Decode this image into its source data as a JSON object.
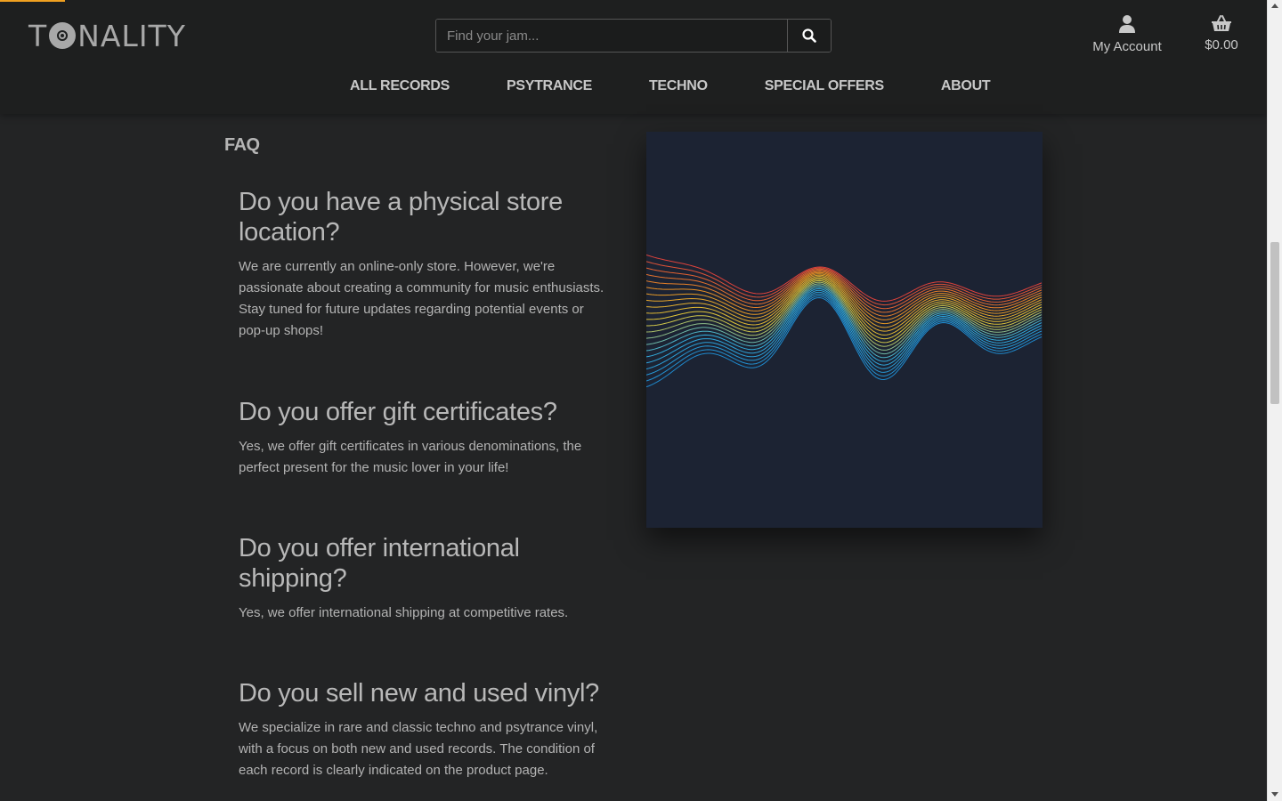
{
  "header": {
    "logo_text_left": "T",
    "logo_text_right": "NALITY",
    "search": {
      "placeholder": "Find your jam..."
    },
    "account_label": "My Account",
    "cart_total": "$0.00",
    "nav": [
      "ALL RECORDS",
      "PSYTRANCE",
      "TECHNO",
      "SPECIAL OFFERS",
      "ABOUT"
    ]
  },
  "main": {
    "heading": "FAQ",
    "faqs": [
      {
        "question": "Do you have a physical store location?",
        "answer": "We are currently an online-only store. However, we're passionate about creating a community for music enthusiasts. Stay tuned for future updates regarding potential events or pop-up shops!"
      },
      {
        "question": "Do you offer gift certificates?",
        "answer": "Yes, we offer gift certificates in various denominations, the perfect present for the music lover in your life!"
      },
      {
        "question": "Do you offer international shipping?",
        "answer": "Yes, we offer international shipping at competitive rates."
      },
      {
        "question": "Do you sell new and used vinyl?",
        "answer": "We specialize in rare and classic techno and psytrance vinyl, with a focus on both new and used records. The condition of each record is clearly indicated on the product page."
      }
    ]
  },
  "colors": {
    "background": "#232425",
    "header_bg": "#1e1f1f",
    "loader_accent": "#f0a020",
    "art_bg": "#1c2333"
  },
  "icons": [
    "search-icon",
    "user-icon",
    "basket-icon"
  ]
}
